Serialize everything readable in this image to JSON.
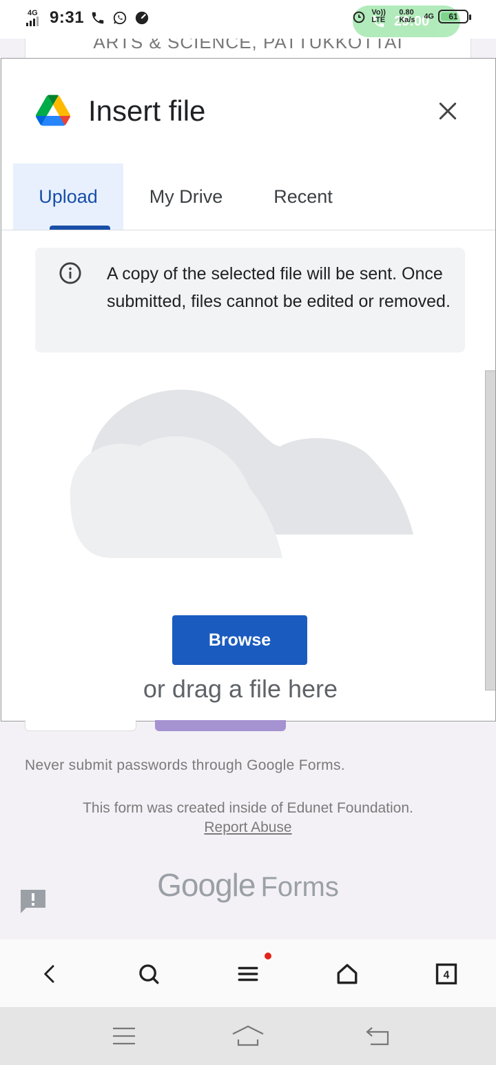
{
  "status_bar": {
    "network": "4G",
    "time": "9:31",
    "call_timer": "29:00",
    "volte": "Vo)) LTE",
    "speed": "0.80 Ka/s",
    "net_right": "4G",
    "battery": "61"
  },
  "background_page": {
    "header_peek": "ARTS & SCIENCE, PATTUKKOTTAI",
    "never_submit": "Never submit passwords through Google Forms.",
    "created_inside": "This form was created inside of Edunet Foundation.",
    "report_abuse": "Report Abuse",
    "logo_google": "Google",
    "logo_forms": "Forms"
  },
  "dialog": {
    "title": "Insert file",
    "tabs": [
      {
        "label": "Upload",
        "active": true
      },
      {
        "label": "My Drive",
        "active": false
      },
      {
        "label": "Recent",
        "active": false
      }
    ],
    "notice": "A copy of the selected file will be sent. Once submitted, files cannot be edited or removed.",
    "browse_label": "Browse",
    "drag_text": "or drag a file here"
  },
  "icons": {
    "close": "close-icon",
    "info": "info-icon",
    "drive": "google-drive-logo",
    "feedback": "feedback-icon"
  },
  "colors": {
    "accent": "#1a5bbf",
    "tab_active_bg": "#e8f0fe",
    "tab_active_text": "#174ea6",
    "forms_purple": "#a592d1"
  }
}
